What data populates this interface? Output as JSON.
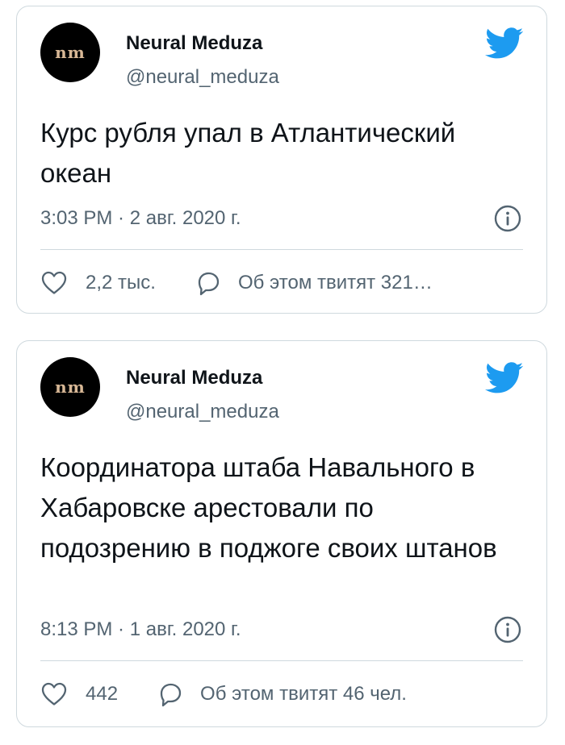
{
  "colors": {
    "twitter_blue": "#1d9bf0",
    "text_primary": "#0f1419",
    "text_secondary": "#536471",
    "border": "#cfd9de",
    "avatar_bg": "#000000",
    "avatar_text": "#d8b896"
  },
  "tweets": [
    {
      "author": {
        "name": "Neural Meduza",
        "handle": "@neural_meduza",
        "avatar_text": "nm"
      },
      "text": "Курс рубля упал в Атлантический океан",
      "timestamp": "3:03 PM · 2 авг. 2020 г.",
      "likes": "2,2 тыс.",
      "replies": "Об этом твитят 321…",
      "icons": [
        "twitter-logo-icon",
        "info-icon",
        "heart-icon",
        "reply-icon"
      ]
    },
    {
      "author": {
        "name": "Neural Meduza",
        "handle": "@neural_meduza",
        "avatar_text": "nm"
      },
      "text": "Координатора штаба Навального в Хабаровске арестовали по подозрению в поджоге своих штанов",
      "timestamp": "8:13 PM · 1 авг. 2020 г.",
      "likes": "442",
      "replies": "Об этом твитят 46 чел.",
      "icons": [
        "twitter-logo-icon",
        "info-icon",
        "heart-icon",
        "reply-icon"
      ]
    }
  ]
}
